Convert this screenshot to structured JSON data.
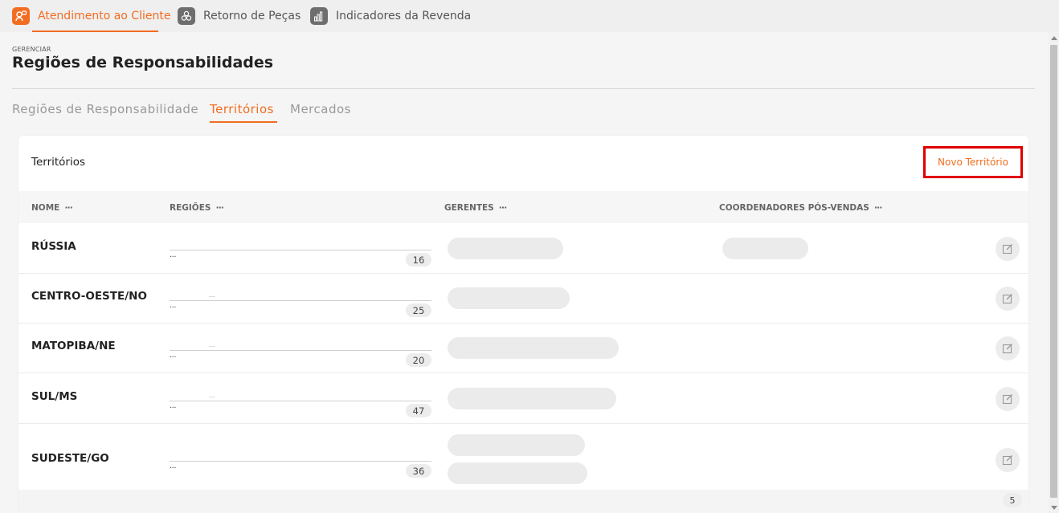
{
  "apps": [
    {
      "label": "Atendimento ao Cliente",
      "active": true,
      "icon": "support-icon"
    },
    {
      "label": "Retorno de Peças",
      "active": false,
      "icon": "parts-icon"
    },
    {
      "label": "Indicadores da Revenda",
      "active": false,
      "icon": "bar-chart-icon"
    }
  ],
  "header": {
    "eyebrow": "GERENCIAR",
    "title": "Regiões de Responsabilidades"
  },
  "subtabs": [
    {
      "label": "Regiões de Responsabilidade",
      "active": false
    },
    {
      "label": "Territórios",
      "active": true
    },
    {
      "label": "Mercados",
      "active": false
    }
  ],
  "card": {
    "title": "Territórios",
    "new_button": "Novo Território"
  },
  "table": {
    "columns": [
      {
        "label": "NOME",
        "menu": "···"
      },
      {
        "label": "REGIÕES",
        "menu": "···"
      },
      {
        "label": "GERENTES",
        "menu": "···"
      },
      {
        "label": "COORDENADORES PÓS-VENDAS",
        "menu": "···"
      }
    ],
    "rows": [
      {
        "name": "RÚSSIA",
        "regions_more": "···",
        "regions_count": "16"
      },
      {
        "name": "CENTRO-OESTE/NO",
        "regions_more": "···",
        "regions_count": "25"
      },
      {
        "name": "MATOPIBA/NE",
        "regions_more": "···",
        "regions_count": "20"
      },
      {
        "name": "SUL/MS",
        "regions_more": "···",
        "regions_count": "47"
      },
      {
        "name": "SUDESTE/GO",
        "regions_more": "···",
        "regions_count": "36"
      }
    ]
  },
  "footer": {
    "total": "5"
  },
  "colors": {
    "accent": "#f26d21",
    "highlight_border": "#e00000",
    "placeholder": "#ebebeb"
  }
}
